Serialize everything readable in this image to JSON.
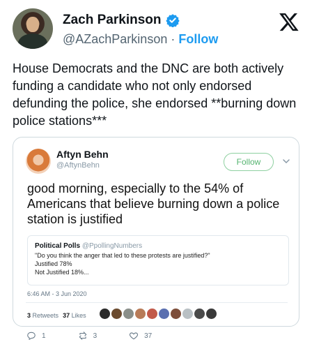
{
  "author": {
    "display_name": "Zach Parkinson",
    "handle": "@AZachParkinson",
    "separator": " · ",
    "follow_label": "Follow",
    "avatar_icon": "profile-photo",
    "verified_icon": "verified-badge-icon",
    "verified_color": "#1d9bf0"
  },
  "logo_icon": "x-logo-icon",
  "tweet": {
    "text": "House Democrats and the DNC are both actively funding a candidate who not only endorsed defunding the police, she endorsed **burning down police stations***"
  },
  "quoted": {
    "display_name": "Aftyn Behn",
    "handle": "@AftynBehn",
    "follow_label": "Follow",
    "text": "good morning, especially to the 54% of Americans that believe burning down a police station is justified",
    "poll_card": {
      "source_name": "Political Polls",
      "source_handle": "@PpollingNumbers",
      "question": "\"Do you think the anger that led to these protests are justified?\"",
      "option1": "Justified 78%",
      "option2": "Not Justified 18%..."
    },
    "timestamp": "6:46 AM - 3 Jun 2020",
    "stats": {
      "retweets_count": "3",
      "retweets_label": "Retweets",
      "likes_count": "37",
      "likes_label": "Likes"
    },
    "actions": {
      "replies": "1",
      "retweets": "3",
      "likes": "37"
    }
  },
  "colors": {
    "accent": "#1d9bf0",
    "follow_green": "#55b470",
    "muted": "#536471"
  }
}
